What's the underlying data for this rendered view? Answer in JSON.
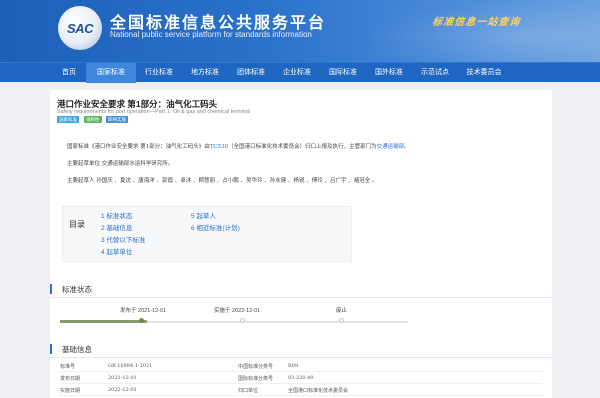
{
  "header": {
    "logo_text": "SAC",
    "title": "全国标准信息公共服务平台",
    "subtitle": "National public service platform  for standards information",
    "slogan": "标准信息一站查询"
  },
  "nav": {
    "items": [
      {
        "label": "首页",
        "active": false
      },
      {
        "label": "国家标准",
        "active": true
      },
      {
        "label": "行业标准",
        "active": false
      },
      {
        "label": "地方标准",
        "active": false
      },
      {
        "label": "团体标准",
        "active": false
      },
      {
        "label": "企业标准",
        "active": false
      },
      {
        "label": "国际标准",
        "active": false
      },
      {
        "label": "国外标准",
        "active": false
      },
      {
        "label": "示范试点",
        "active": false
      },
      {
        "label": "技术委员会",
        "active": false
      }
    ]
  },
  "doc": {
    "title": "港口作业安全要求 第1部分：油气化工码头",
    "subtitle": "Safety requirements for port operation—Part 1: Oil & gas and chemical terminal",
    "tags": [
      {
        "label": "国家标准",
        "color": "#3fa3d9"
      },
      {
        "label": "强制性",
        "color": "#58b35e"
      },
      {
        "label": "即将实施",
        "color": "#4a8bd6"
      }
    ],
    "intro_prefix": "国家标准《港口作业安全要求 第1部分：油气化工码头》由",
    "intro_tc": "TC530",
    "intro_middle": "（全国港口标准化技术委员会）归口上报及执行，主管部门为",
    "intro_dept": "交通运输部",
    "intro_suffix": "。",
    "drafting_unit": "主要起草单位 交通运输部水运科学研究所。",
    "drafters": "主要起草人 孙国庆 、夏沈 、唐海洋 、郭霞 、卓沐 、顾慧丽 、占小鹏 、吴华玲 、孙永健 、杨锐 、傅玲 、吕广宇 、褚冠全 。"
  },
  "toc": {
    "label": "目录",
    "items": [
      "1  标准状态",
      "2  基础信息",
      "3  代替以下标准",
      "4  起草单位",
      "5  起草人",
      "6  相近标准(计划)"
    ]
  },
  "status": {
    "section_title": "标准状态",
    "published": "发布于 2021-12-01",
    "implemented": "实施于 2022-12-01",
    "abolished": "废止",
    "progress": 0.25
  },
  "basic": {
    "section_title": "基础信息",
    "rows": [
      [
        "标准号",
        "GB 16994.1-2021",
        "中国标准分类号",
        "R09"
      ],
      [
        "发布日期",
        "2021-12-01",
        "国际标准分类号",
        "03.220.40"
      ],
      [
        "实施日期",
        "2022-12-01",
        "归口单位",
        "全国港口标准化技术委员会"
      ]
    ]
  }
}
